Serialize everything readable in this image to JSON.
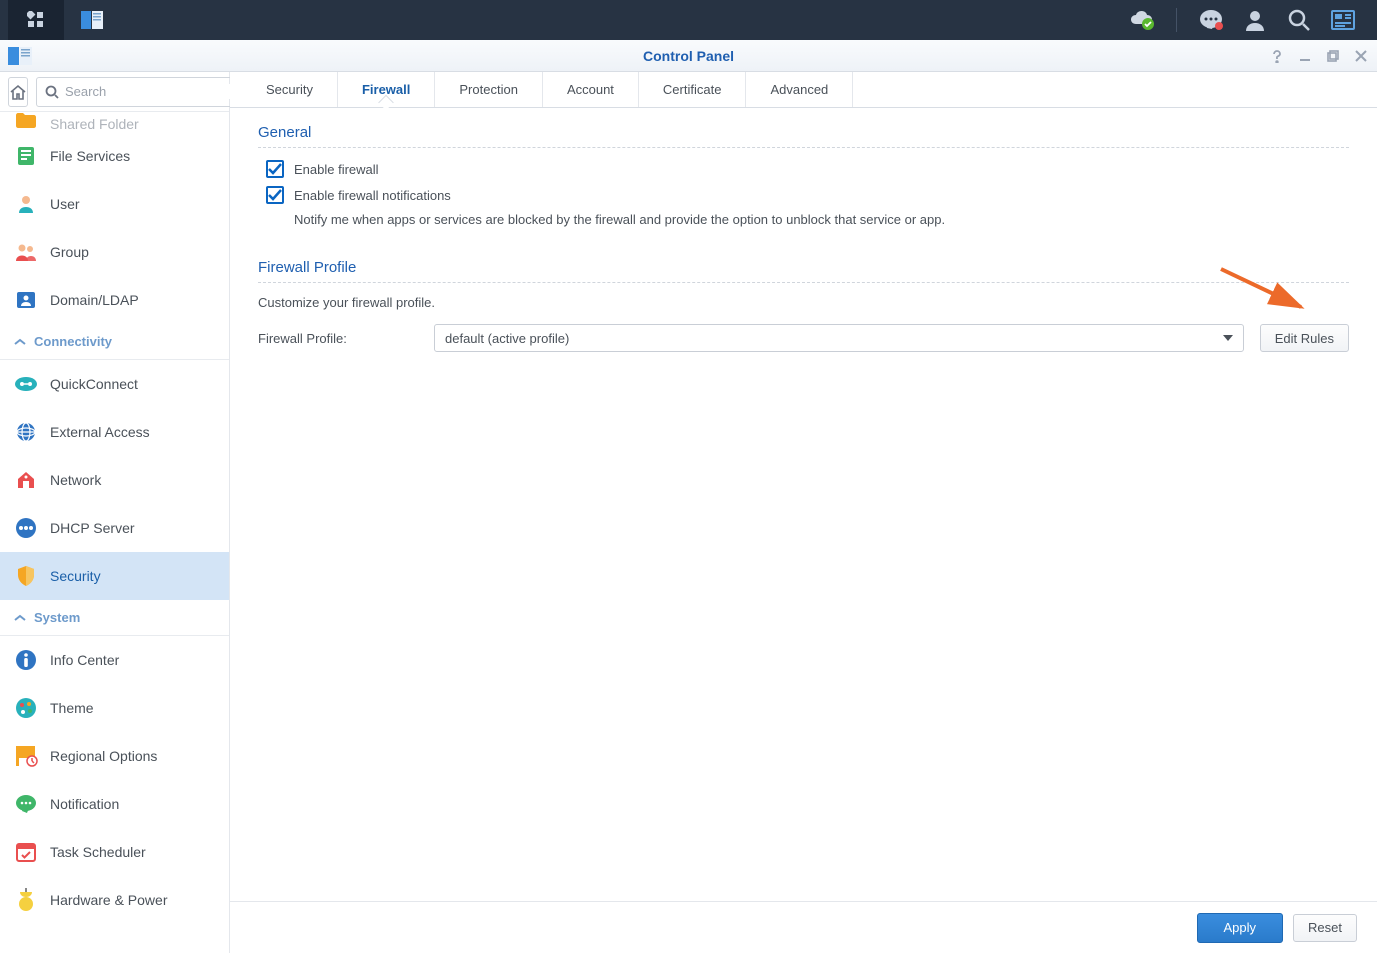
{
  "taskbar": {
    "main_menu": "main-menu",
    "app_icon": "control-panel-launcher"
  },
  "window": {
    "title": "Control Panel",
    "search_placeholder": "Search"
  },
  "sidebar": {
    "partial_item": "Shared Folder",
    "items_top": [
      {
        "id": "file-services",
        "label": "File Services",
        "icon": "file-services"
      },
      {
        "id": "user",
        "label": "User",
        "icon": "user"
      },
      {
        "id": "group",
        "label": "Group",
        "icon": "group"
      },
      {
        "id": "domain-ldap",
        "label": "Domain/LDAP",
        "icon": "domain-ldap"
      }
    ],
    "group_connectivity": "Connectivity",
    "items_connectivity": [
      {
        "id": "quickconnect",
        "label": "QuickConnect",
        "icon": "quickconnect"
      },
      {
        "id": "external-access",
        "label": "External Access",
        "icon": "external-access"
      },
      {
        "id": "network",
        "label": "Network",
        "icon": "network"
      },
      {
        "id": "dhcp-server",
        "label": "DHCP Server",
        "icon": "dhcp"
      },
      {
        "id": "security",
        "label": "Security",
        "icon": "security",
        "active": true
      }
    ],
    "group_system": "System",
    "items_system": [
      {
        "id": "info-center",
        "label": "Info Center",
        "icon": "info"
      },
      {
        "id": "theme",
        "label": "Theme",
        "icon": "theme"
      },
      {
        "id": "regional",
        "label": "Regional Options",
        "icon": "regional"
      },
      {
        "id": "notification",
        "label": "Notification",
        "icon": "notification"
      },
      {
        "id": "task-scheduler",
        "label": "Task Scheduler",
        "icon": "task"
      },
      {
        "id": "hardware-power",
        "label": "Hardware & Power",
        "icon": "hardware"
      }
    ]
  },
  "tabs": [
    {
      "id": "security",
      "label": "Security"
    },
    {
      "id": "firewall",
      "label": "Firewall",
      "active": true
    },
    {
      "id": "protection",
      "label": "Protection"
    },
    {
      "id": "account",
      "label": "Account"
    },
    {
      "id": "certificate",
      "label": "Certificate"
    },
    {
      "id": "advanced",
      "label": "Advanced"
    }
  ],
  "panel": {
    "general_title": "General",
    "enable_firewall_label": "Enable firewall",
    "enable_firewall_checked": true,
    "enable_notifications_label": "Enable firewall notifications",
    "enable_notifications_checked": true,
    "notifications_help": "Notify me when apps or services are blocked by the firewall and provide the option to unblock that service or app.",
    "profile_title": "Firewall Profile",
    "profile_desc": "Customize your firewall profile.",
    "profile_label": "Firewall Profile:",
    "profile_value": "default (active profile)",
    "edit_rules_label": "Edit Rules"
  },
  "footer": {
    "apply": "Apply",
    "reset": "Reset"
  }
}
